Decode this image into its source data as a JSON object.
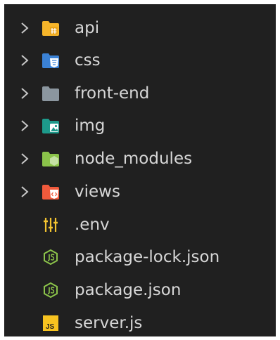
{
  "explorer": {
    "items": [
      {
        "label": "api",
        "type": "folder",
        "icon": "folder-api-icon"
      },
      {
        "label": "css",
        "type": "folder",
        "icon": "folder-css-icon"
      },
      {
        "label": "front-end",
        "type": "folder",
        "icon": "folder-icon"
      },
      {
        "label": "img",
        "type": "folder",
        "icon": "folder-images-icon"
      },
      {
        "label": "node_modules",
        "type": "folder",
        "icon": "folder-node-icon"
      },
      {
        "label": "views",
        "type": "folder",
        "icon": "folder-views-icon"
      },
      {
        "label": ".env",
        "type": "file",
        "icon": "env-settings-icon"
      },
      {
        "label": "package-lock.json",
        "type": "file",
        "icon": "nodejs-icon"
      },
      {
        "label": "package.json",
        "type": "file",
        "icon": "nodejs-icon"
      },
      {
        "label": "server.js",
        "type": "file",
        "icon": "javascript-icon"
      }
    ]
  },
  "colors": {
    "background": "#202020",
    "text": "#d7d7d7",
    "chevron": "#c8c8c8",
    "api_folder": "#f6b52a",
    "css_folder": "#3b82d6",
    "plain_folder": "#8b969f",
    "img_folder": "#1d9a8b",
    "node_folder": "#8bc34a",
    "views_folder": "#f05a3c",
    "env_icon": "#f4c430",
    "node_icon": "#8bc34a",
    "js_icon": "#f7c320"
  }
}
